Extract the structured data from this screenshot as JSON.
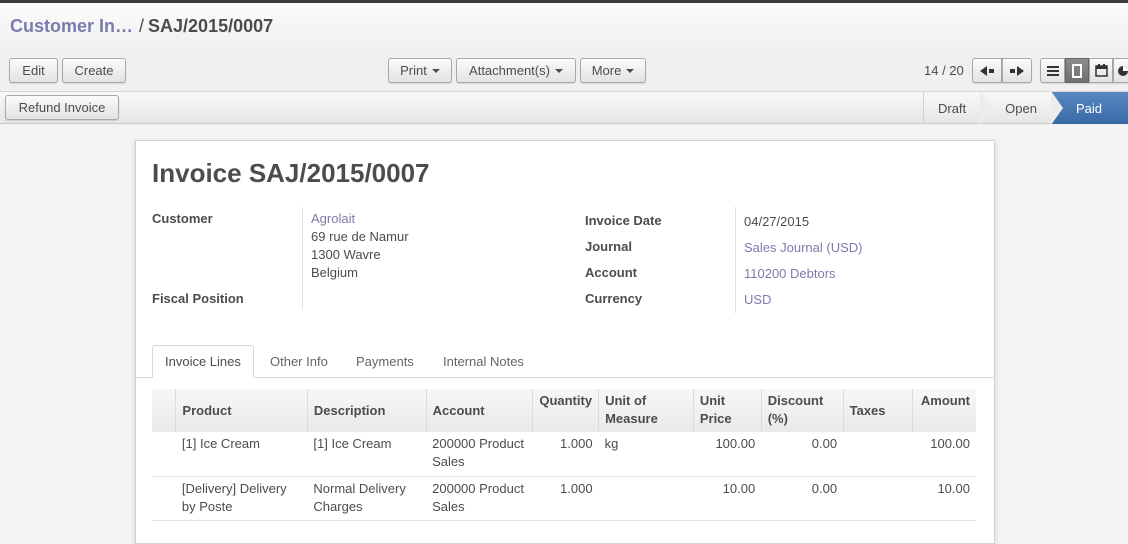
{
  "breadcrumb": {
    "parent": "Customer In…",
    "separator": "/",
    "current": "SAJ/2015/0007"
  },
  "toolbar": {
    "edit_label": "Edit",
    "create_label": "Create",
    "print_label": "Print",
    "attachments_label": "Attachment(s)",
    "more_label": "More",
    "pager": "14 / 20"
  },
  "status": {
    "refund_label": "Refund Invoice",
    "stages": [
      "Draft",
      "Open",
      "Paid"
    ],
    "active_stage": "Paid",
    "accent_color": "#4a78b8"
  },
  "form": {
    "title": "Invoice SAJ/2015/0007",
    "customer_label": "Customer",
    "customer_name": "Agrolait",
    "address_line1": "69 rue de Namur",
    "address_line2": "1300 Wavre",
    "address_line3": "Belgium",
    "fiscal_position_label": "Fiscal Position",
    "invoice_date_label": "Invoice Date",
    "invoice_date": "04/27/2015",
    "journal_label": "Journal",
    "journal": "Sales Journal (USD)",
    "account_label": "Account",
    "account": "110200 Debtors",
    "currency_label": "Currency",
    "currency": "USD"
  },
  "tabs": [
    "Invoice Lines",
    "Other Info",
    "Payments",
    "Internal Notes"
  ],
  "lines": {
    "headers": {
      "product": "Product",
      "description": "Description",
      "account": "Account",
      "quantity": "Quantity",
      "uom_1": "Unit of",
      "uom_2": "Measure",
      "price_1": "Unit",
      "price_2": "Price",
      "discount_1": "Discount",
      "discount_2": "(%)",
      "taxes": "Taxes",
      "amount": "Amount"
    },
    "rows": [
      {
        "product_1": "[1] Ice Cream",
        "product_2": "",
        "description_1": "[1] Ice Cream",
        "description_2": "",
        "account_1": "200000 Product",
        "account_2": "Sales",
        "quantity": "1.000",
        "uom": "kg",
        "price": "100.00",
        "discount": "0.00",
        "taxes": "",
        "amount": "100.00"
      },
      {
        "product_1": "[Delivery] Delivery",
        "product_2": "by Poste",
        "description_1": "Normal Delivery",
        "description_2": "Charges",
        "account_1": "200000 Product",
        "account_2": "Sales",
        "quantity": "1.000",
        "uom": "",
        "price": "10.00",
        "discount": "0.00",
        "taxes": "",
        "amount": "10.00"
      }
    ]
  }
}
